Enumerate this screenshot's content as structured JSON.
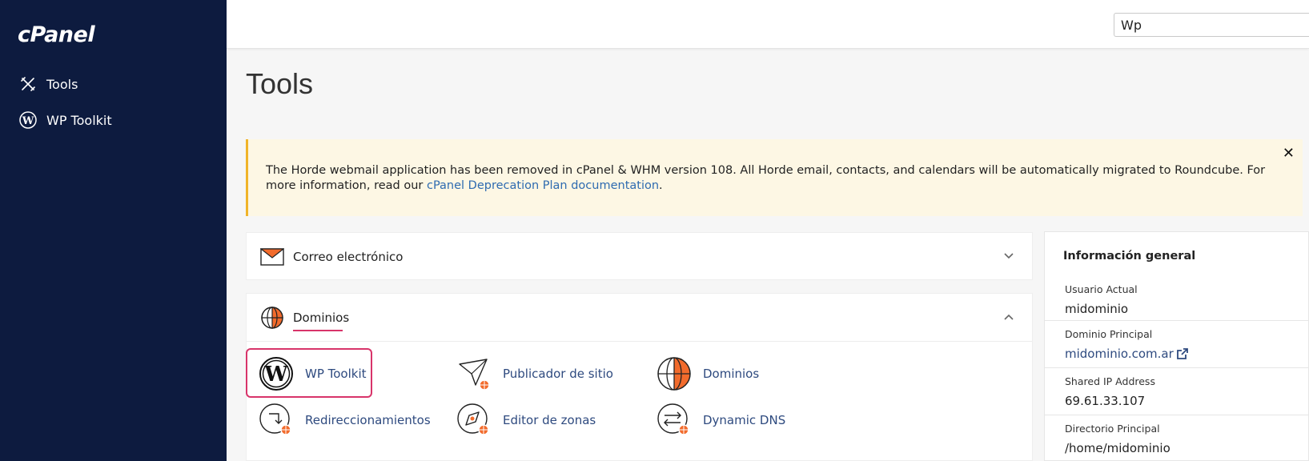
{
  "sidebar": {
    "logo": "cPanel",
    "items": [
      {
        "label": "Tools",
        "icon": "tools-icon"
      },
      {
        "label": "WP Toolkit",
        "icon": "wordpress-icon"
      }
    ]
  },
  "topbar": {
    "search_value": "Wp"
  },
  "main": {
    "title": "Tools",
    "alert": {
      "text_before": "The Horde webmail application has been removed in cPanel & WHM version 108. All Horde email, contacts, and calendars will be automatically migrated to Roundcube. For more information, read our ",
      "link_text": "cPanel Deprecation Plan documentation",
      "text_after": "."
    },
    "sections": [
      {
        "title": "Correo electrónico",
        "icon": "envelope-icon",
        "expanded": false
      },
      {
        "title": "Dominios",
        "icon": "globe-icon",
        "expanded": true
      }
    ],
    "domain_tools": [
      {
        "label": "WP Toolkit",
        "icon": "wordpress-icon"
      },
      {
        "label": "Publicador de sitio",
        "icon": "paper-plane-icon"
      },
      {
        "label": "Dominios",
        "icon": "globe-icon"
      },
      {
        "label": "Redireccionamientos",
        "icon": "redirect-icon"
      },
      {
        "label": "Editor de zonas",
        "icon": "zone-editor-icon"
      },
      {
        "label": "Dynamic DNS",
        "icon": "dns-icon"
      }
    ]
  },
  "info": {
    "title": "Información general",
    "rows": [
      {
        "key": "Usuario Actual",
        "value": "midominio"
      },
      {
        "key": "Dominio Principal",
        "value": "midominio.com.ar"
      },
      {
        "key": "Shared IP Address",
        "value": "69.61.33.107"
      },
      {
        "key": "Directorio Principal",
        "value": "/home/midominio"
      }
    ]
  },
  "colors": {
    "sidebar_bg": "#0d1b3f",
    "accent": "#d8346a",
    "orange": "#f26b2c",
    "link": "#2e4a7f",
    "alert_bg": "#fdf7e4"
  }
}
